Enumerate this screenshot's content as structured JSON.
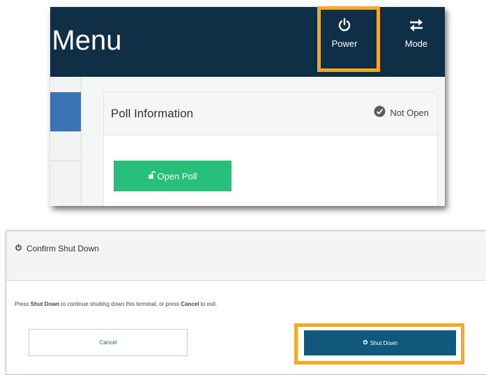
{
  "header": {
    "title": "r Menu",
    "power_label": "Power",
    "mode_label": "Mode",
    "power_icon": "power-icon",
    "mode_icon": "swap-arrows-icon"
  },
  "poll_card": {
    "title": "Poll Information",
    "status": "Not Open",
    "status_icon": "check-circle-icon",
    "open_button_label": "Open Poll",
    "open_button_icon": "unlock-icon"
  },
  "dialog": {
    "title": "Confirm Shut Down",
    "title_icon": "power-icon",
    "message_prefix": "Press ",
    "message_bold_1": "Shut Down",
    "message_middle": " to continue shutting down this terminal, or press ",
    "message_bold_2": "Cancel",
    "message_suffix": " to exit.",
    "cancel_label": "Cancel",
    "shutdown_label": "Shut Down"
  },
  "colors": {
    "header_bg": "#0e2f45",
    "highlight": "#f7a823",
    "open_poll_green": "#27c07a",
    "shutdown_blue": "#11597c",
    "left_tab_blue": "#3b73b5"
  }
}
